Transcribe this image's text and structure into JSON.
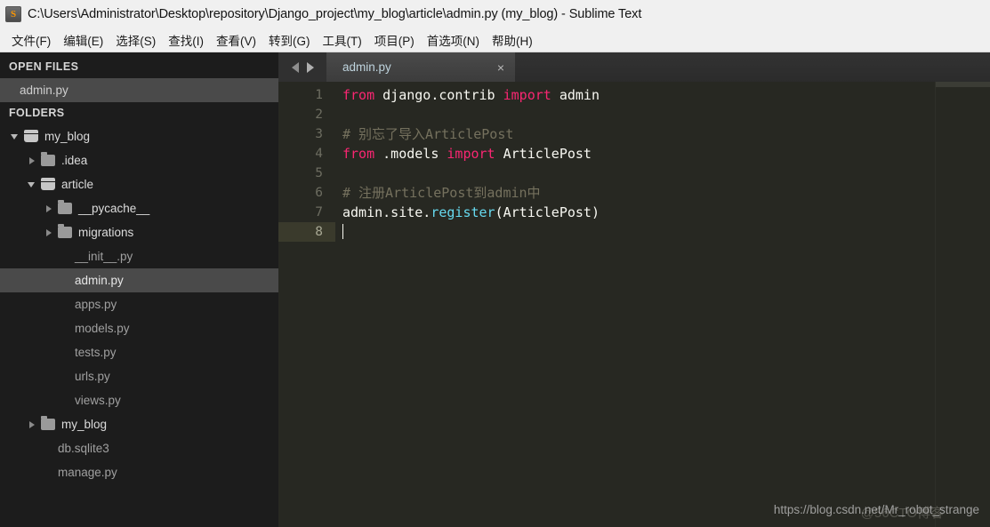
{
  "window": {
    "title": "C:\\Users\\Administrator\\Desktop\\repository\\Django_project\\my_blog\\article\\admin.py (my_blog) - Sublime Text",
    "app_icon_letter": "S"
  },
  "menubar": {
    "items": [
      {
        "label": "文件(F)",
        "name": "menu-file"
      },
      {
        "label": "编辑(E)",
        "name": "menu-edit"
      },
      {
        "label": "选择(S)",
        "name": "menu-selection"
      },
      {
        "label": "查找(I)",
        "name": "menu-find"
      },
      {
        "label": "查看(V)",
        "name": "menu-view"
      },
      {
        "label": "转到(G)",
        "name": "menu-goto"
      },
      {
        "label": "工具(T)",
        "name": "menu-tools"
      },
      {
        "label": "项目(P)",
        "name": "menu-project"
      },
      {
        "label": "首选项(N)",
        "name": "menu-preferences"
      },
      {
        "label": "帮助(H)",
        "name": "menu-help"
      }
    ]
  },
  "sidebar": {
    "open_files_header": "OPEN FILES",
    "open_files": [
      {
        "label": "admin.py",
        "selected": true
      }
    ],
    "folders_header": "FOLDERS",
    "tree": [
      {
        "label": "my_blog",
        "type": "folder",
        "state": "open",
        "indent": 0
      },
      {
        "label": ".idea",
        "type": "folder",
        "state": "closed",
        "indent": 1
      },
      {
        "label": "article",
        "type": "folder",
        "state": "open",
        "indent": 1
      },
      {
        "label": "__pycache__",
        "type": "folder",
        "state": "closed",
        "indent": 2
      },
      {
        "label": "migrations",
        "type": "folder",
        "state": "closed",
        "indent": 2
      },
      {
        "label": "__init__.py",
        "type": "file",
        "state": "none",
        "indent": 3
      },
      {
        "label": "admin.py",
        "type": "file",
        "state": "none",
        "indent": 3,
        "selected": true
      },
      {
        "label": "apps.py",
        "type": "file",
        "state": "none",
        "indent": 3
      },
      {
        "label": "models.py",
        "type": "file",
        "state": "none",
        "indent": 3
      },
      {
        "label": "tests.py",
        "type": "file",
        "state": "none",
        "indent": 3
      },
      {
        "label": "urls.py",
        "type": "file",
        "state": "none",
        "indent": 3
      },
      {
        "label": "views.py",
        "type": "file",
        "state": "none",
        "indent": 3
      },
      {
        "label": "my_blog",
        "type": "folder",
        "state": "closed",
        "indent": 1
      },
      {
        "label": "db.sqlite3",
        "type": "file",
        "state": "none",
        "indent": 2
      },
      {
        "label": "manage.py",
        "type": "file",
        "state": "none",
        "indent": 2
      }
    ]
  },
  "tabbar": {
    "nav_prev": "◀",
    "nav_next": "▶",
    "tabs": [
      {
        "label": "admin.py",
        "close": "×",
        "active": true
      }
    ]
  },
  "editor": {
    "line_numbers": [
      "1",
      "2",
      "3",
      "4",
      "5",
      "6",
      "7",
      "8"
    ],
    "active_line": 8,
    "lines": [
      {
        "n": 1,
        "tokens": [
          {
            "t": "from",
            "c": "kw"
          },
          {
            "t": " django.contrib ",
            "c": "pl"
          },
          {
            "t": "import",
            "c": "kw"
          },
          {
            "t": " admin",
            "c": "pl"
          }
        ]
      },
      {
        "n": 2,
        "tokens": []
      },
      {
        "n": 3,
        "tokens": [
          {
            "t": "# 别忘了导入ArticlePost",
            "c": "cm"
          }
        ]
      },
      {
        "n": 4,
        "tokens": [
          {
            "t": "from",
            "c": "kw"
          },
          {
            "t": " .models ",
            "c": "pl"
          },
          {
            "t": "import",
            "c": "kw"
          },
          {
            "t": " ArticlePost",
            "c": "pl"
          }
        ]
      },
      {
        "n": 5,
        "tokens": []
      },
      {
        "n": 6,
        "tokens": [
          {
            "t": "# 注册ArticlePost到admin中",
            "c": "cm"
          }
        ]
      },
      {
        "n": 7,
        "tokens": [
          {
            "t": "admin.site.",
            "c": "pl"
          },
          {
            "t": "register",
            "c": "fn"
          },
          {
            "t": "(ArticlePost)",
            "c": "pl"
          }
        ]
      },
      {
        "n": 8,
        "tokens": []
      }
    ]
  },
  "overlay": {
    "watermark": "https://blog.csdn.net/Mr_robot_strange",
    "stamp": "@56CTO博客"
  },
  "colors": {
    "editor_bg": "#272822",
    "sidebar_bg": "#1c1c1c",
    "keyword": "#f92672",
    "function": "#66d9ef",
    "comment": "#75715e",
    "plain": "#f8f8f2",
    "selection": "#4a4a4a",
    "active_line": "#3a3a2c"
  }
}
